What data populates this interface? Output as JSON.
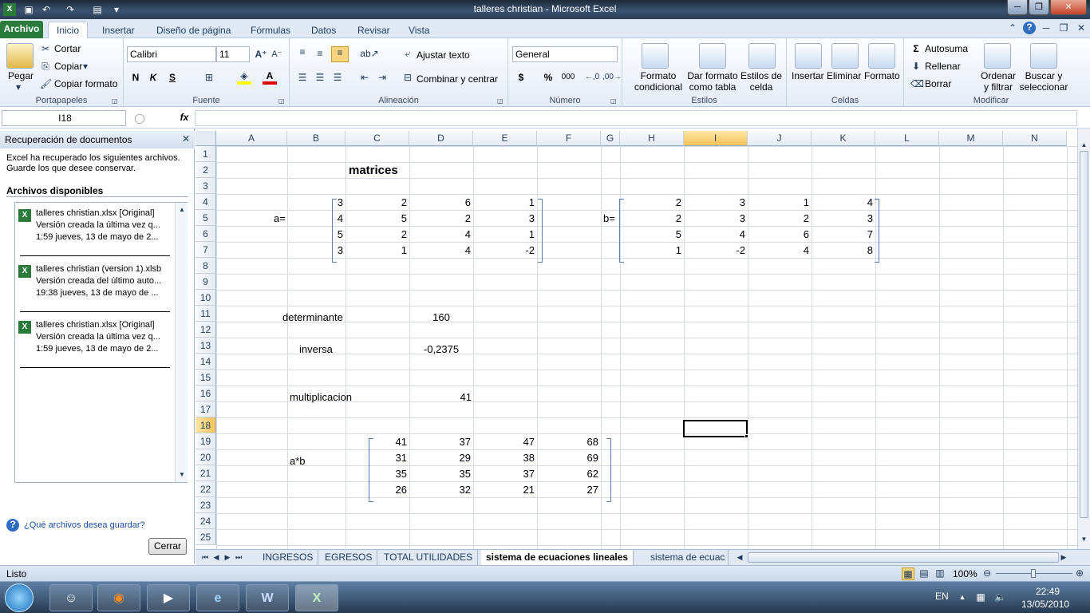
{
  "window": {
    "title": "talleres christian  -  Microsoft Excel"
  },
  "tabs": [
    "Archivo",
    "Inicio",
    "Insertar",
    "Diseño de página",
    "Fórmulas",
    "Datos",
    "Revisar",
    "Vista"
  ],
  "ribbon": {
    "clipboard": {
      "label": "Portapapeles",
      "paste": "Pegar",
      "cut": "Cortar",
      "copy": "Copiar",
      "format_painter": "Copiar formato"
    },
    "font": {
      "label": "Fuente",
      "name": "Calibri",
      "size": "11",
      "bold": "N",
      "italic": "K",
      "underline": "S"
    },
    "alignment": {
      "label": "Alineación",
      "wrap": "Ajustar texto",
      "merge": "Combinar y centrar"
    },
    "number": {
      "label": "Número",
      "format": "General",
      "currency": "$",
      "percent": "%",
      "thousands": "000",
      "inc_dec": "⁺⁰.₀₀",
      "dec_dec": ",₀₀→,₀"
    },
    "styles": {
      "label": "Estilos",
      "conditional": "Formato condicional",
      "table": "Dar formato como tabla",
      "cell_styles": "Estilos de celda"
    },
    "cells": {
      "label": "Celdas",
      "insert": "Insertar",
      "delete": "Eliminar",
      "format": "Formato"
    },
    "editing": {
      "label": "Modificar",
      "autosum": "Autosuma",
      "fill": "Rellenar",
      "clear": "Borrar",
      "sort": "Ordenar y filtrar",
      "find": "Buscar y seleccionar"
    }
  },
  "formula_bar": {
    "name_box": "I18",
    "fx": "fx",
    "value": ""
  },
  "recovery": {
    "title": "Recuperación de documentos",
    "intro1": "Excel ha recuperado los siguientes archivos.",
    "intro2": "Guarde los que desee conservar.",
    "available": "Archivos disponibles",
    "files": [
      {
        "name": "talleres christian.xlsx  [Original]",
        "line2": "Versión creada la última vez q...",
        "line3": "1:59 jueves, 13 de mayo de 2..."
      },
      {
        "name": "talleres christian (version 1).xlsb",
        "line2": "Versión creada del último auto...",
        "line3": "19:38 jueves, 13 de mayo de ..."
      },
      {
        "name": "talleres christian.xlsx  [Original]",
        "line2": "Versión creada la última vez q...",
        "line3": "1:59 jueves, 13 de mayo de 2..."
      }
    ],
    "help": "¿Qué archivos desea guardar?",
    "close": "Cerrar"
  },
  "columns": [
    "A",
    "B",
    "C",
    "D",
    "E",
    "F",
    "G",
    "H",
    "I",
    "J",
    "K",
    "L",
    "M",
    "N"
  ],
  "rows": [
    "1",
    "2",
    "3",
    "4",
    "5",
    "6",
    "7",
    "8",
    "9",
    "10",
    "11",
    "12",
    "13",
    "14",
    "15",
    "16",
    "17",
    "18",
    "19",
    "20",
    "21",
    "22",
    "23",
    "24",
    "25"
  ],
  "sheet": {
    "title": "matrices",
    "a_label": "a=",
    "b_label": "b=",
    "matrix_a": [
      [
        "3",
        "2",
        "6",
        "1"
      ],
      [
        "4",
        "5",
        "2",
        "3"
      ],
      [
        "5",
        "2",
        "4",
        "1"
      ],
      [
        "3",
        "1",
        "4",
        "-2"
      ]
    ],
    "matrix_b": [
      [
        "2",
        "3",
        "1",
        "4"
      ],
      [
        "2",
        "3",
        "2",
        "3"
      ],
      [
        "5",
        "4",
        "6",
        "7"
      ],
      [
        "1",
        "-2",
        "4",
        "8"
      ]
    ],
    "det_label": "determinante",
    "det_value": "160",
    "inv_label": "inversa",
    "inv_value": "-0,2375",
    "mult_label": "multiplicacion",
    "mult_value": "41",
    "ab_label": "a*b",
    "matrix_ab": [
      [
        "41",
        "37",
        "47",
        "68"
      ],
      [
        "31",
        "29",
        "38",
        "69"
      ],
      [
        "35",
        "35",
        "37",
        "62"
      ],
      [
        "26",
        "32",
        "21",
        "27"
      ]
    ]
  },
  "sheet_tabs": [
    "INGRESOS",
    "EGRESOS",
    "TOTAL UTILIDADES",
    "sistema de ecuaciones lineales",
    "sistema de ecuac"
  ],
  "status": {
    "ready": "Listo",
    "zoom": "100%"
  },
  "taskbar": {
    "lang": "EN",
    "time": "22:49",
    "date": "13/05/2010"
  }
}
